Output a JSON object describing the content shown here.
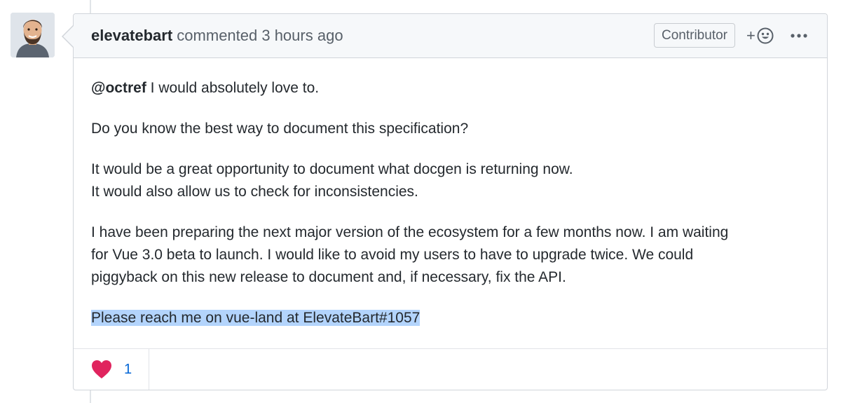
{
  "comment": {
    "author": "elevatebart",
    "action": " commented 3 hours ago",
    "role_badge": "Contributor",
    "add_reaction_label": "+",
    "body": {
      "mention": "@octref",
      "p1_rest": " I would absolutely love to.",
      "p2": "Do you know the best way to document this specification?",
      "p3_line1": "It would be a great opportunity to document what docgen is returning now.",
      "p3_line2": "It would also allow us to check for inconsistencies.",
      "p4_line1": "I have been preparing the next major version of the ecosystem for a few months now. I am waiting",
      "p4_line2": "for Vue 3.0 beta to launch. I would like to avoid my users to have to upgrade twice. We could",
      "p4_line3": "piggyback on this new release to document and, if necessary, fix the API.",
      "p5": "Please reach me on vue-land at ElevateBart#1057"
    },
    "reactions": [
      {
        "icon": "heart-icon",
        "count": "1"
      }
    ]
  },
  "colors": {
    "link": "#0366d6",
    "highlight": "#b3d4fc",
    "heart": "#e0245e"
  }
}
